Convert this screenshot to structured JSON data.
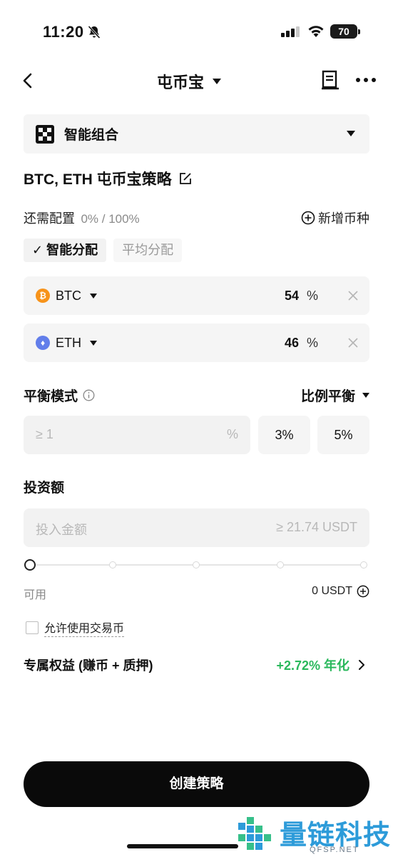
{
  "status_bar": {
    "time": "11:20",
    "battery": "70",
    "icons": [
      "bell-off-icon",
      "signal-icon",
      "wifi-icon",
      "battery-icon"
    ]
  },
  "nav": {
    "title": "屯币宝",
    "icons": [
      "back-icon",
      "chevron-down-icon",
      "document-icon",
      "more-icon"
    ]
  },
  "portfolio_select": {
    "label": "智能组合",
    "icon": "okx-logo"
  },
  "strategy": {
    "title": "BTC, ETH 屯币宝策略",
    "icon": "edit-icon"
  },
  "config": {
    "label": "还需配置",
    "value": "0% / 100%",
    "add_coin_label": "新增币种"
  },
  "allocation_tabs": [
    {
      "label": "✓ 智能分配",
      "active": true
    },
    {
      "label": "平均分配",
      "active": false
    }
  ],
  "coins": [
    {
      "symbol": "BTC",
      "icon_glyph": "₿",
      "color": "#f7931a",
      "percent": "54",
      "unit": "%"
    },
    {
      "symbol": "ETH",
      "icon_glyph": "♦",
      "color": "#627eea",
      "percent": "46",
      "unit": "%"
    }
  ],
  "balance": {
    "label": "平衡模式",
    "mode": "比例平衡",
    "threshold_placeholder": "≥ 1",
    "threshold_unit": "%",
    "presets": [
      "3%",
      "5%"
    ]
  },
  "investment": {
    "title": "投资额",
    "placeholder": "投入金额",
    "minimum": "≥ 21.74 USDT",
    "slider_value": 0
  },
  "available": {
    "label": "可用",
    "value": "0 USDT"
  },
  "allow_trading_coin": {
    "label": "允许使用交易币",
    "checked": false
  },
  "benefit": {
    "label": "专属权益 (赚币 + 质押)",
    "value": "+2.72% 年化",
    "color": "#2ab85c"
  },
  "create_button": {
    "label": "创建策略"
  },
  "watermark": {
    "text": "量链科技",
    "url": "QFSP.NET",
    "color": "#2d9bd9"
  }
}
